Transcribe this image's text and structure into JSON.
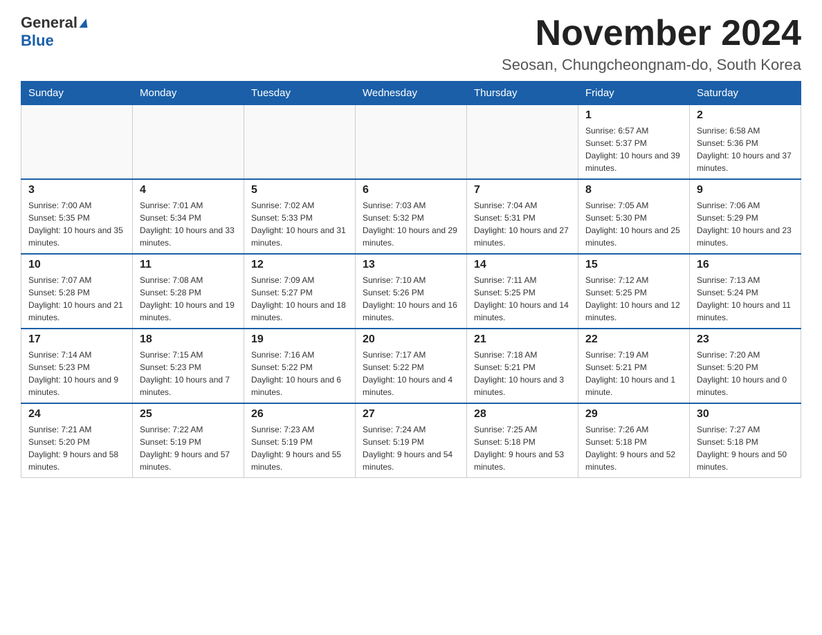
{
  "header": {
    "logo_general": "General",
    "logo_blue": "Blue",
    "month_title": "November 2024",
    "location": "Seosan, Chungcheongnam-do, South Korea"
  },
  "weekdays": [
    "Sunday",
    "Monday",
    "Tuesday",
    "Wednesday",
    "Thursday",
    "Friday",
    "Saturday"
  ],
  "weeks": [
    [
      {
        "day": "",
        "info": ""
      },
      {
        "day": "",
        "info": ""
      },
      {
        "day": "",
        "info": ""
      },
      {
        "day": "",
        "info": ""
      },
      {
        "day": "",
        "info": ""
      },
      {
        "day": "1",
        "info": "Sunrise: 6:57 AM\nSunset: 5:37 PM\nDaylight: 10 hours and 39 minutes."
      },
      {
        "day": "2",
        "info": "Sunrise: 6:58 AM\nSunset: 5:36 PM\nDaylight: 10 hours and 37 minutes."
      }
    ],
    [
      {
        "day": "3",
        "info": "Sunrise: 7:00 AM\nSunset: 5:35 PM\nDaylight: 10 hours and 35 minutes."
      },
      {
        "day": "4",
        "info": "Sunrise: 7:01 AM\nSunset: 5:34 PM\nDaylight: 10 hours and 33 minutes."
      },
      {
        "day": "5",
        "info": "Sunrise: 7:02 AM\nSunset: 5:33 PM\nDaylight: 10 hours and 31 minutes."
      },
      {
        "day": "6",
        "info": "Sunrise: 7:03 AM\nSunset: 5:32 PM\nDaylight: 10 hours and 29 minutes."
      },
      {
        "day": "7",
        "info": "Sunrise: 7:04 AM\nSunset: 5:31 PM\nDaylight: 10 hours and 27 minutes."
      },
      {
        "day": "8",
        "info": "Sunrise: 7:05 AM\nSunset: 5:30 PM\nDaylight: 10 hours and 25 minutes."
      },
      {
        "day": "9",
        "info": "Sunrise: 7:06 AM\nSunset: 5:29 PM\nDaylight: 10 hours and 23 minutes."
      }
    ],
    [
      {
        "day": "10",
        "info": "Sunrise: 7:07 AM\nSunset: 5:28 PM\nDaylight: 10 hours and 21 minutes."
      },
      {
        "day": "11",
        "info": "Sunrise: 7:08 AM\nSunset: 5:28 PM\nDaylight: 10 hours and 19 minutes."
      },
      {
        "day": "12",
        "info": "Sunrise: 7:09 AM\nSunset: 5:27 PM\nDaylight: 10 hours and 18 minutes."
      },
      {
        "day": "13",
        "info": "Sunrise: 7:10 AM\nSunset: 5:26 PM\nDaylight: 10 hours and 16 minutes."
      },
      {
        "day": "14",
        "info": "Sunrise: 7:11 AM\nSunset: 5:25 PM\nDaylight: 10 hours and 14 minutes."
      },
      {
        "day": "15",
        "info": "Sunrise: 7:12 AM\nSunset: 5:25 PM\nDaylight: 10 hours and 12 minutes."
      },
      {
        "day": "16",
        "info": "Sunrise: 7:13 AM\nSunset: 5:24 PM\nDaylight: 10 hours and 11 minutes."
      }
    ],
    [
      {
        "day": "17",
        "info": "Sunrise: 7:14 AM\nSunset: 5:23 PM\nDaylight: 10 hours and 9 minutes."
      },
      {
        "day": "18",
        "info": "Sunrise: 7:15 AM\nSunset: 5:23 PM\nDaylight: 10 hours and 7 minutes."
      },
      {
        "day": "19",
        "info": "Sunrise: 7:16 AM\nSunset: 5:22 PM\nDaylight: 10 hours and 6 minutes."
      },
      {
        "day": "20",
        "info": "Sunrise: 7:17 AM\nSunset: 5:22 PM\nDaylight: 10 hours and 4 minutes."
      },
      {
        "day": "21",
        "info": "Sunrise: 7:18 AM\nSunset: 5:21 PM\nDaylight: 10 hours and 3 minutes."
      },
      {
        "day": "22",
        "info": "Sunrise: 7:19 AM\nSunset: 5:21 PM\nDaylight: 10 hours and 1 minute."
      },
      {
        "day": "23",
        "info": "Sunrise: 7:20 AM\nSunset: 5:20 PM\nDaylight: 10 hours and 0 minutes."
      }
    ],
    [
      {
        "day": "24",
        "info": "Sunrise: 7:21 AM\nSunset: 5:20 PM\nDaylight: 9 hours and 58 minutes."
      },
      {
        "day": "25",
        "info": "Sunrise: 7:22 AM\nSunset: 5:19 PM\nDaylight: 9 hours and 57 minutes."
      },
      {
        "day": "26",
        "info": "Sunrise: 7:23 AM\nSunset: 5:19 PM\nDaylight: 9 hours and 55 minutes."
      },
      {
        "day": "27",
        "info": "Sunrise: 7:24 AM\nSunset: 5:19 PM\nDaylight: 9 hours and 54 minutes."
      },
      {
        "day": "28",
        "info": "Sunrise: 7:25 AM\nSunset: 5:18 PM\nDaylight: 9 hours and 53 minutes."
      },
      {
        "day": "29",
        "info": "Sunrise: 7:26 AM\nSunset: 5:18 PM\nDaylight: 9 hours and 52 minutes."
      },
      {
        "day": "30",
        "info": "Sunrise: 7:27 AM\nSunset: 5:18 PM\nDaylight: 9 hours and 50 minutes."
      }
    ]
  ]
}
